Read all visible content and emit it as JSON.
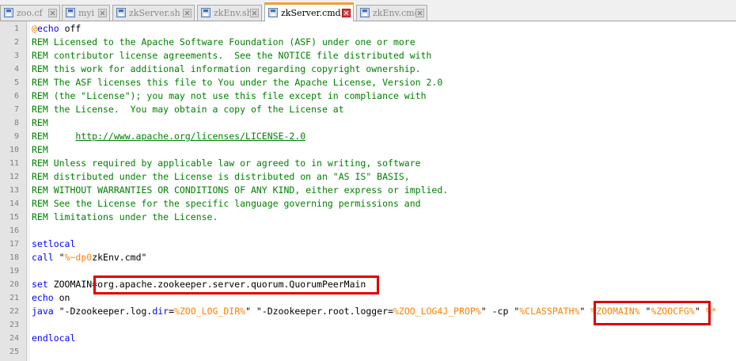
{
  "tabs": [
    {
      "label": "zoo.cf",
      "active": false
    },
    {
      "label": "myi",
      "active": false
    },
    {
      "label": "zkServer.sh",
      "active": false
    },
    {
      "label": "zkEnv.sh",
      "active": false
    },
    {
      "label": "zkServer.cmd",
      "active": true
    },
    {
      "label": "zkEnv.cmd",
      "active": false
    }
  ],
  "colors": {
    "comment": "#008000",
    "keyword": "#0000ff",
    "variable": "#ff8000",
    "highlight_box": "#e00000",
    "active_tab_accent": "#f0a030"
  },
  "lines": [
    {
      "n": "1",
      "segs": [
        {
          "t": "@",
          "c": "vr"
        },
        {
          "t": "echo",
          "c": "kw"
        },
        {
          "t": " off",
          "c": ""
        }
      ]
    },
    {
      "n": "2",
      "segs": [
        {
          "t": "REM Licensed to the Apache Software Foundation (ASF) under one or more",
          "c": "rem"
        }
      ]
    },
    {
      "n": "3",
      "segs": [
        {
          "t": "REM contributor license agreements.  See the NOTICE file distributed with",
          "c": "rem"
        }
      ]
    },
    {
      "n": "4",
      "segs": [
        {
          "t": "REM this work for additional information regarding copyright ownership.",
          "c": "rem"
        }
      ]
    },
    {
      "n": "5",
      "segs": [
        {
          "t": "REM The ASF licenses this file to You under the Apache License, Version 2.0",
          "c": "rem"
        }
      ]
    },
    {
      "n": "6",
      "segs": [
        {
          "t": "REM (the \"License\"); you may not use this file except in compliance with",
          "c": "rem"
        }
      ]
    },
    {
      "n": "7",
      "segs": [
        {
          "t": "REM the License.  You may obtain a copy of the License at",
          "c": "rem"
        }
      ]
    },
    {
      "n": "8",
      "segs": [
        {
          "t": "REM",
          "c": "rem"
        }
      ]
    },
    {
      "n": "9",
      "segs": [
        {
          "t": "REM     ",
          "c": "rem"
        },
        {
          "t": "http://www.apache.org/licenses/LICENSE-2.0",
          "c": "url"
        }
      ]
    },
    {
      "n": "10",
      "segs": [
        {
          "t": "REM",
          "c": "rem"
        }
      ]
    },
    {
      "n": "11",
      "segs": [
        {
          "t": "REM Unless required by applicable law or agreed to in writing, software",
          "c": "rem"
        }
      ]
    },
    {
      "n": "12",
      "segs": [
        {
          "t": "REM distributed under the License is distributed on an \"AS IS\" BASIS,",
          "c": "rem"
        }
      ]
    },
    {
      "n": "13",
      "segs": [
        {
          "t": "REM WITHOUT WARRANTIES OR CONDITIONS OF ANY KIND, either express or implied.",
          "c": "rem"
        }
      ]
    },
    {
      "n": "14",
      "segs": [
        {
          "t": "REM See the License for the specific language governing permissions and",
          "c": "rem"
        }
      ]
    },
    {
      "n": "15",
      "segs": [
        {
          "t": "REM limitations under the License.",
          "c": "rem"
        }
      ]
    },
    {
      "n": "16",
      "segs": []
    },
    {
      "n": "17",
      "segs": [
        {
          "t": "setlocal",
          "c": "kw"
        }
      ]
    },
    {
      "n": "18",
      "segs": [
        {
          "t": "call",
          "c": "kw"
        },
        {
          "t": " \"",
          "c": ""
        },
        {
          "t": "%~dp0",
          "c": "vr"
        },
        {
          "t": "zkEnv.cmd\"",
          "c": ""
        }
      ]
    },
    {
      "n": "19",
      "segs": []
    },
    {
      "n": "20",
      "segs": [
        {
          "t": "set",
          "c": "kw"
        },
        {
          "t": " ZOOMAIN=org.apache.zookeeper.server.quorum.QuorumPeerMain",
          "c": ""
        }
      ]
    },
    {
      "n": "21",
      "segs": [
        {
          "t": "echo",
          "c": "kw"
        },
        {
          "t": " on",
          "c": ""
        }
      ]
    },
    {
      "n": "22",
      "segs": [
        {
          "t": "java",
          "c": "kw"
        },
        {
          "t": " \"-Dzookeeper.log.",
          "c": ""
        },
        {
          "t": "dir",
          "c": "kw"
        },
        {
          "t": "=",
          "c": ""
        },
        {
          "t": "%ZOO_LOG_DIR%",
          "c": "vr"
        },
        {
          "t": "\" \"-Dzookeeper.root.logger=",
          "c": ""
        },
        {
          "t": "%ZOO_LOG4J_PROP%",
          "c": "vr"
        },
        {
          "t": "\" -cp \"",
          "c": ""
        },
        {
          "t": "%CLASSPATH%",
          "c": "vr"
        },
        {
          "t": "\" ",
          "c": ""
        },
        {
          "t": "%ZOOMAIN%",
          "c": "vr"
        },
        {
          "t": " \"",
          "c": ""
        },
        {
          "t": "%ZOOCFG%",
          "c": "vr"
        },
        {
          "t": "\" ",
          "c": ""
        },
        {
          "t": "%*",
          "c": "vr"
        }
      ]
    },
    {
      "n": "23",
      "segs": []
    },
    {
      "n": "24",
      "segs": [
        {
          "t": "endlocal",
          "c": "kw"
        }
      ]
    },
    {
      "n": "25",
      "segs": []
    }
  ]
}
